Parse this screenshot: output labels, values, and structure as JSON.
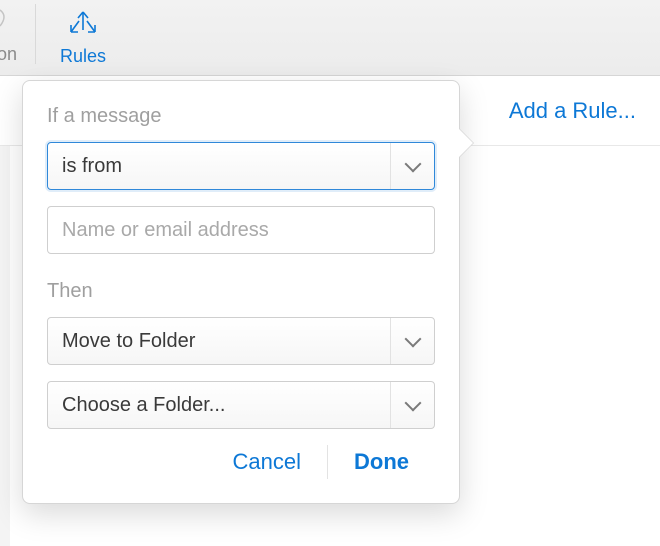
{
  "toolbar": {
    "prev_tab_fragment": "tion",
    "rules_label": "Rules"
  },
  "link": {
    "add_rule": "Add a Rule..."
  },
  "popover": {
    "if_label": "If a message",
    "condition_select": "is from",
    "address_placeholder": "Name or email address",
    "then_label": "Then",
    "action_select": "Move to Folder",
    "folder_select": "Choose a Folder...",
    "cancel": "Cancel",
    "done": "Done"
  }
}
